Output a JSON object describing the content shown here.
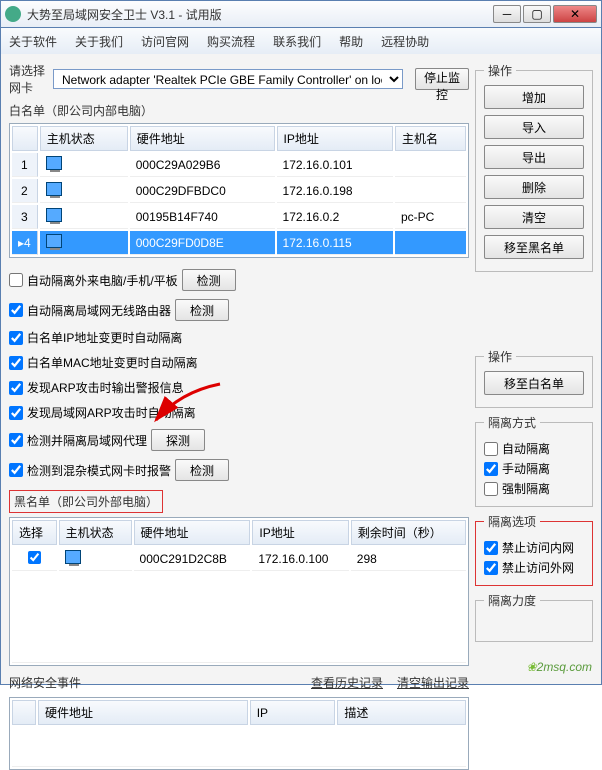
{
  "window": {
    "title": "大势至局域网安全卫士 V3.1 - 试用版"
  },
  "menu": [
    "关于软件",
    "关于我们",
    "访问官网",
    "购买流程",
    "联系我们",
    "帮助",
    "远程协助"
  ],
  "nic": {
    "label": "请选择网卡",
    "value": "Network adapter 'Realtek PCIe GBE Family Controller' on loca",
    "stopBtn": "停止监控"
  },
  "whitelist": {
    "legend": "白名单（即公司内部电脑）",
    "cols": {
      "status": "主机状态",
      "mac": "硬件地址",
      "ip": "IP地址",
      "host": "主机名"
    },
    "rows": [
      {
        "n": "1",
        "mac": "000C29A029B6",
        "ip": "172.16.0.101",
        "host": ""
      },
      {
        "n": "2",
        "mac": "000C29DFBDC0",
        "ip": "172.16.0.198",
        "host": ""
      },
      {
        "n": "3",
        "mac": "00195B14F740",
        "ip": "172.16.0.2",
        "host": "pc-PC"
      },
      {
        "n": "4",
        "mac": "000C29FD0D8E",
        "ip": "172.16.0.115",
        "host": ""
      }
    ]
  },
  "ops": {
    "legend": "操作",
    "add": "增加",
    "import": "导入",
    "export": "导出",
    "del": "删除",
    "clear": "清空",
    "toBlack": "移至黑名单",
    "toWhite": "移至白名单"
  },
  "opts": {
    "autoIsolateExt": "自动隔离外来电脑/手机/平板",
    "detect": "检测",
    "autoIsolateRouter": "自动隔离局域网无线路由器",
    "ipChange": "白名单IP地址变更时自动隔离",
    "macChange": "白名单MAC地址变更时自动隔离",
    "arpAlert": "发现ARP攻击时输出警报信息",
    "arpIsolate": "发现局域网ARP攻击时自动隔离",
    "proxy": "检测并隔离局域网代理",
    "probe": "探测",
    "promisc": "检测到混杂模式网卡时报警"
  },
  "blacklist": {
    "legend": "黑名单（即公司外部电脑）",
    "cols": {
      "sel": "选择",
      "status": "主机状态",
      "mac": "硬件地址",
      "ip": "IP地址",
      "time": "剩余时间（秒）"
    },
    "rows": [
      {
        "mac": "000C291D2C8B",
        "ip": "172.16.0.100",
        "time": "298"
      }
    ]
  },
  "isoMode": {
    "legend": "隔离方式",
    "auto": "自动隔离",
    "manual": "手动隔离",
    "force": "强制隔离"
  },
  "isoOpt": {
    "legend": "隔离选项",
    "noIn": "禁止访问内网",
    "noOut": "禁止访问外网"
  },
  "isoPower": {
    "legend": "隔离力度"
  },
  "events": {
    "legend": "网络安全事件",
    "history": "查看历史记录",
    "clear": "清空输出记录",
    "cols": {
      "mac": "硬件地址",
      "ip": "IP",
      "desc": "描述"
    }
  },
  "watermark": "2msq.com"
}
